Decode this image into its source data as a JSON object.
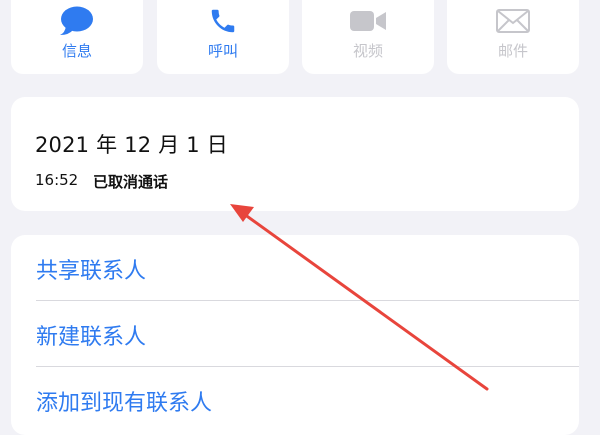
{
  "actions": {
    "message": {
      "label": "信息",
      "icon": "message-bubble-icon"
    },
    "call": {
      "label": "呼叫",
      "icon": "phone-icon"
    },
    "video": {
      "label": "视频",
      "icon": "video-camera-icon"
    },
    "mail": {
      "label": "邮件",
      "icon": "mail-icon"
    }
  },
  "call_log": {
    "date": "2021 年 12 月 1 日",
    "time": "16:52",
    "status": "已取消通话"
  },
  "menu": {
    "items": [
      {
        "label": "共享联系人"
      },
      {
        "label": "新建联系人"
      },
      {
        "label": "添加到现有联系人"
      }
    ]
  },
  "colors": {
    "accent": "#2f7bf0",
    "disabled": "#c6c6cb",
    "annotation_arrow": "#e8453c",
    "background": "#f2f2f7"
  }
}
